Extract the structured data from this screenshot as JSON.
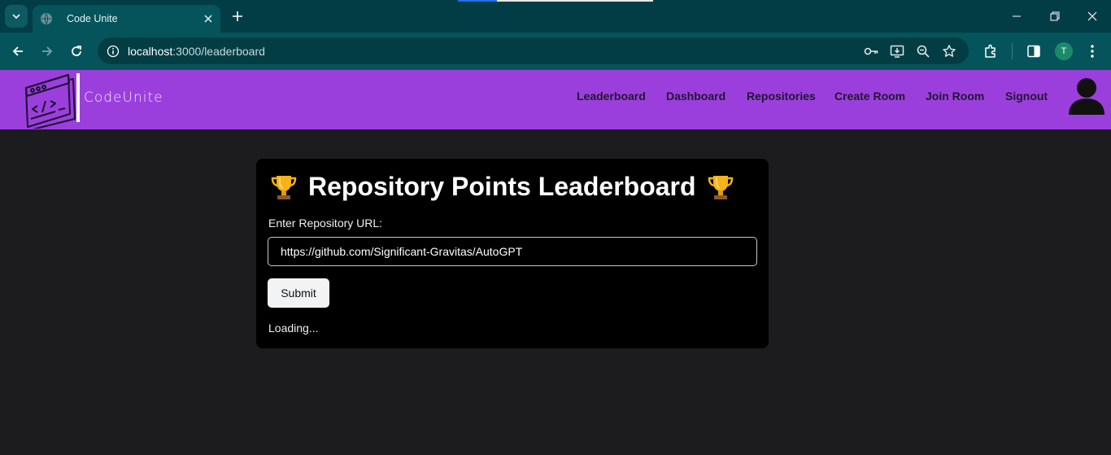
{
  "browser": {
    "tab_title": "Code Unite",
    "url_host": "localhost",
    "url_path": ":3000/leaderboard",
    "profile_initial": "T"
  },
  "app": {
    "logo_text": "CodeUnite",
    "nav": [
      "Leaderboard",
      "Dashboard",
      "Repositories",
      "Create Room",
      "Join Room",
      "Signout"
    ]
  },
  "card": {
    "title": "Repository Points Leaderboard",
    "input_label": "Enter Repository URL:",
    "input_value": "https://github.com/Significant-Gravitas/AutoGPT",
    "submit_label": "Submit",
    "status": "Loading..."
  },
  "colors": {
    "tabbar": "#023d45",
    "toolbar": "#05545c",
    "header": "#9b3fdc",
    "page_bg": "#1c1c1e",
    "card_bg": "#000000"
  },
  "icons": [
    "tab-search-icon",
    "globe-icon",
    "close-icon",
    "plus-icon",
    "minimize-icon",
    "restore-icon",
    "back-icon",
    "forward-icon",
    "reload-icon",
    "site-info-icon",
    "key-icon",
    "install-icon",
    "zoom-icon",
    "star-icon",
    "extensions-icon",
    "side-panel-icon",
    "menu-icon",
    "trophy-icon",
    "user-avatar-icon"
  ]
}
